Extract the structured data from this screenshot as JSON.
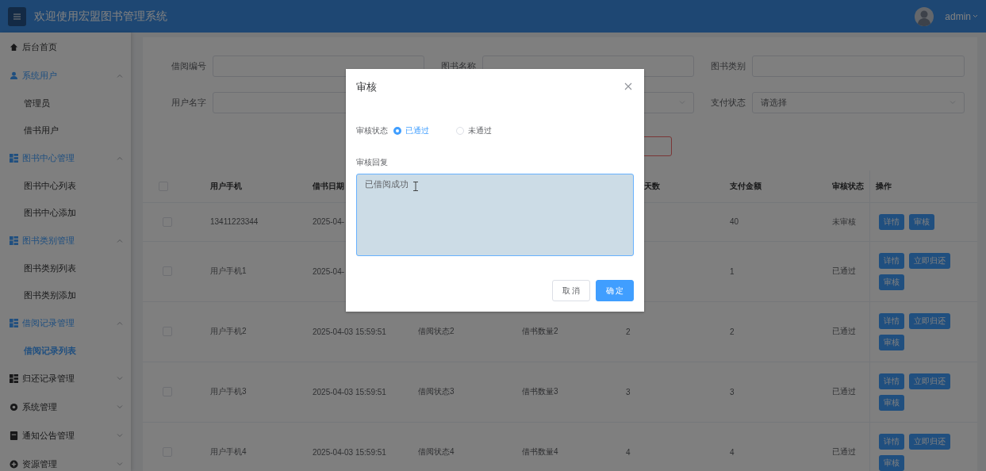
{
  "header": {
    "title": "欢迎使用宏盟图书管理系统",
    "user": "admin"
  },
  "sidebar": {
    "items": [
      {
        "label": "后台首页",
        "selected": false
      },
      {
        "label": "系统用户",
        "expanded": true,
        "children": [
          {
            "label": "管理员",
            "selected": false
          },
          {
            "label": "借书用户",
            "selected": false
          }
        ]
      },
      {
        "label": "图书中心管理",
        "expanded": true,
        "children": [
          {
            "label": "图书中心列表",
            "selected": false
          },
          {
            "label": "图书中心添加",
            "selected": false
          }
        ]
      },
      {
        "label": "图书类别管理",
        "expanded": true,
        "children": [
          {
            "label": "图书类别列表",
            "selected": false
          },
          {
            "label": "图书类别添加",
            "selected": false
          }
        ]
      },
      {
        "label": "借阅记录管理",
        "expanded": true,
        "children": [
          {
            "label": "借阅记录列表",
            "selected": true
          }
        ]
      },
      {
        "label": "归还记录管理",
        "expanded": false
      },
      {
        "label": "系统管理",
        "expanded": false
      },
      {
        "label": "通知公告管理",
        "expanded": false
      },
      {
        "label": "资源管理",
        "expanded": false
      }
    ]
  },
  "search_form": {
    "fields": [
      {
        "kind": "input",
        "label": "借阅编号"
      },
      {
        "kind": "input",
        "label": "图书名称"
      },
      {
        "kind": "input",
        "label": "图书类别"
      },
      {
        "kind": "input",
        "label": "用户名字"
      },
      {
        "kind": "select"
      },
      {
        "kind": "select",
        "label": "支付状态",
        "placeholder": "请选择"
      }
    ],
    "buttons": [
      {
        "kind": "danger"
      }
    ]
  },
  "table": {
    "columns": [
      "用户手机",
      "借书日期",
      null,
      null,
      "天数",
      "支付金额",
      "审核状态",
      "操作"
    ],
    "header_checked": false,
    "rows": [
      {
        "checked": false,
        "cells": [
          "13411223344",
          "2025-04-",
          null,
          null,
          null,
          "40",
          "未审核"
        ],
        "actions": [
          "详情",
          "审核"
        ]
      },
      {
        "checked": false,
        "cells": [
          "用户手机1",
          "2025-04-",
          null,
          null,
          null,
          "1",
          "已通过"
        ],
        "actions": [
          "详情",
          "立即归还",
          "审核"
        ]
      },
      {
        "checked": false,
        "cells": [
          "用户手机2",
          "2025-04-03 15:59:51",
          "借阅状态2",
          "借书数量2",
          "2",
          "2",
          "已通过"
        ],
        "actions": [
          "详情",
          "立即归还",
          "审核"
        ]
      },
      {
        "checked": false,
        "cells": [
          "用户手机3",
          "2025-04-03 15:59:51",
          "借阅状态3",
          "借书数量3",
          "3",
          "3",
          "已通过"
        ],
        "actions": [
          "详情",
          "立即归还",
          "审核"
        ]
      },
      {
        "checked": false,
        "cells": [
          "用户手机4",
          "2025-04-03 15:59:51",
          "借阅状态4",
          "借书数量4",
          "4",
          "4",
          "已通过"
        ],
        "actions": [
          "详情",
          "立即归还",
          "审核"
        ]
      }
    ]
  },
  "dialog": {
    "title": "审核",
    "status_label": "审核状态",
    "options": [
      {
        "label": "已通过",
        "selected": true
      },
      {
        "label": "未通过",
        "selected": false
      }
    ],
    "reply_label": "审核回复",
    "reply_value": "已借阅成功",
    "buttons": [
      {
        "label": "取 消",
        "kind": "default"
      },
      {
        "label": "确 定",
        "kind": "primary"
      }
    ]
  }
}
